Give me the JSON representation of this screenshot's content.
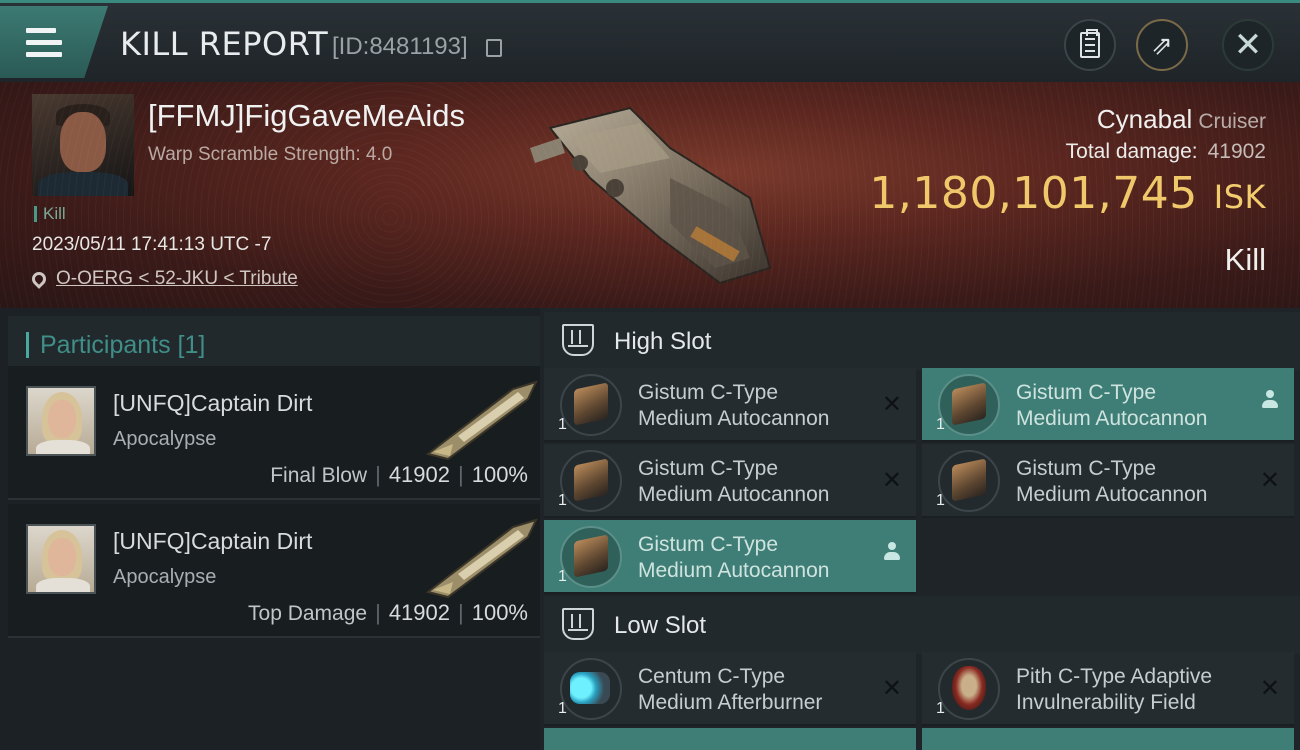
{
  "header": {
    "title": "KILL REPORT",
    "report_id": "[ID:8481193]"
  },
  "victim": {
    "name": "[FFMJ]FigGaveMeAids",
    "warp_scramble": "Warp Scramble Strength: 4.0",
    "kill_tag": "Kill",
    "datetime": "2023/05/11 17:41:13 UTC -7",
    "location": "O-OERG < 52-JKU < Tribute",
    "ship_name": "Cynabal",
    "ship_class": "Cruiser",
    "total_damage_label": "Total damage:",
    "total_damage": "41902",
    "isk_value": "1,180,101,745",
    "isk_unit": "ISK",
    "result": "Kill"
  },
  "participants": {
    "header": "Participants [1]",
    "items": [
      {
        "name": "[UNFQ]Captain Dirt",
        "ship": "Apocalypse",
        "role": "Final Blow",
        "damage": "41902",
        "percent": "100%"
      },
      {
        "name": "[UNFQ]Captain Dirt",
        "ship": "Apocalypse",
        "role": "Top Damage",
        "damage": "41902",
        "percent": "100%"
      }
    ]
  },
  "fitting": {
    "high_slot": {
      "title": "High Slot",
      "modules": [
        {
          "line1": "Gistum C-Type",
          "line2": "Medium Autocannon",
          "qty": "1",
          "status": "destroyed",
          "icon": "autocannon-icon"
        },
        {
          "line1": "Gistum C-Type",
          "line2": "Medium Autocannon",
          "qty": "1",
          "status": "dropped",
          "icon": "autocannon-icon"
        },
        {
          "line1": "Gistum C-Type",
          "line2": "Medium Autocannon",
          "qty": "1",
          "status": "destroyed",
          "icon": "autocannon-icon"
        },
        {
          "line1": "Gistum C-Type",
          "line2": "Medium Autocannon",
          "qty": "1",
          "status": "destroyed",
          "icon": "autocannon-icon"
        },
        {
          "line1": "Gistum C-Type",
          "line2": "Medium Autocannon",
          "qty": "1",
          "status": "dropped",
          "icon": "autocannon-icon"
        }
      ]
    },
    "low_slot": {
      "title": "Low Slot",
      "modules": [
        {
          "line1": "Centum C-Type",
          "line2": "Medium Afterburner",
          "qty": "1",
          "status": "destroyed",
          "icon": "afterburner-icon"
        },
        {
          "line1": "Pith C-Type Adaptive",
          "line2": "Invulnerability Field",
          "qty": "1",
          "status": "destroyed",
          "icon": "shield-field-icon"
        }
      ]
    }
  },
  "colors": {
    "accent_teal": "#3e7e76",
    "isk_gold": "#f0c86a",
    "banner_red": "#5a261f"
  }
}
